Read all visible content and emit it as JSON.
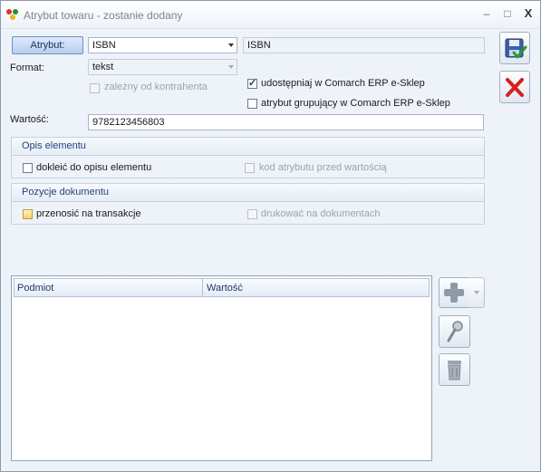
{
  "window": {
    "title": "Atrybut towaru - zostanie dodany",
    "controls": {
      "minimize": "–",
      "maximize": "□",
      "close": "X"
    }
  },
  "form": {
    "attribute_button": "Atrybut:",
    "attribute_select_value": "ISBN",
    "attribute_name_value": "ISBN",
    "format_label": "Format:",
    "format_value": "tekst",
    "dependent_on_contractor": {
      "label": "zależny od kontrahenta",
      "checked": false,
      "enabled": false
    },
    "share_eshop": {
      "label": "udostępniaj w Comarch ERP e-Sklep",
      "checked": true,
      "enabled": true
    },
    "grouping_eshop": {
      "label": "atrybut grupujący w Comarch ERP e-Sklep",
      "checked": false,
      "enabled": true
    },
    "value_label": "Wartość:",
    "value": "9782123456803"
  },
  "element_description": {
    "title": "Opis elementu",
    "append_to_description": {
      "label": "dokleić do opisu elementu",
      "checked": false,
      "enabled": true
    },
    "attribute_code_before_value": {
      "label": "kod atrybutu przed wartością",
      "checked": false,
      "enabled": false
    }
  },
  "document_items": {
    "title": "Pozycje dokumentu",
    "transfer_to_transactions": {
      "label": "przenosić na transakcje",
      "checked": false,
      "enabled": true
    },
    "print_on_documents": {
      "label": "drukować na dokumentach",
      "checked": false,
      "enabled": false
    }
  },
  "grid": {
    "columns": [
      "Podmiot",
      "Wartość"
    ],
    "rows": []
  },
  "actions": {
    "save": "save-icon",
    "cancel": "cancel-icon",
    "add": "plus-icon",
    "edit": "magnifier-icon",
    "delete": "trash-icon"
  }
}
